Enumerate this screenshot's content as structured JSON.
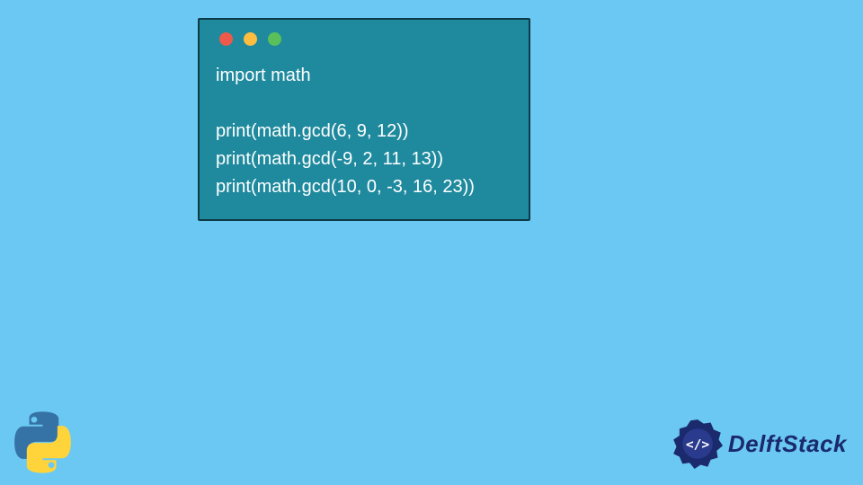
{
  "code": {
    "lines": [
      "import math",
      "",
      "print(math.gcd(6, 9, 12))",
      "print(math.gcd(-9, 2, 11, 13))",
      "print(math.gcd(10, 0, -3, 16, 23))"
    ]
  },
  "window": {
    "dot_colors": {
      "red": "#ed594a",
      "yellow": "#fdbd41",
      "green": "#5ac05a"
    },
    "background": "#1f8a9e",
    "border": "#0d3a47"
  },
  "page": {
    "background": "#6bc8f2"
  },
  "brand": {
    "name": "DelftStack",
    "color": "#1a2a6c"
  },
  "icons": {
    "language": "python",
    "brand_badge": "code-tag-icon"
  }
}
